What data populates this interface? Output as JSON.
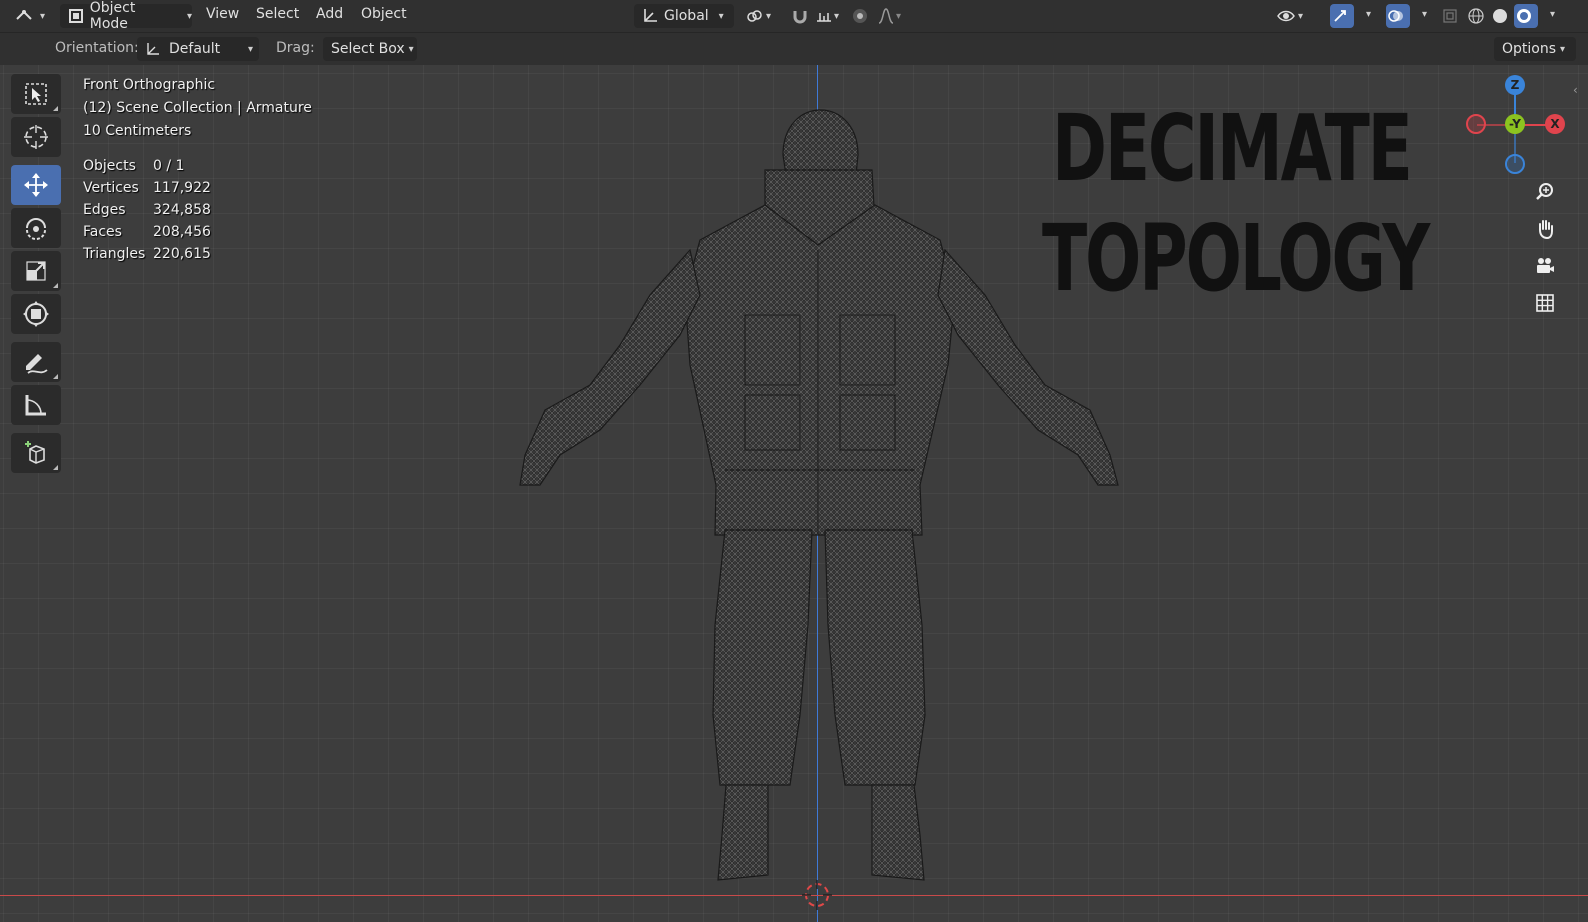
{
  "header": {
    "mode": "Object Mode",
    "menus": [
      "View",
      "Select",
      "Add",
      "Object"
    ],
    "transform_orientation": "Global",
    "options_label": "Options"
  },
  "toolsettings": {
    "orientation_label": "Orientation:",
    "orientation_value": "Default",
    "drag_label": "Drag:",
    "drag_value": "Select Box"
  },
  "viewport": {
    "view_name": "Front Orthographic",
    "collection": "(12) Scene Collection | Armature",
    "scale": "10 Centimeters",
    "stats": [
      {
        "label": "Objects",
        "value": "0 / 1"
      },
      {
        "label": "Vertices",
        "value": "117,922"
      },
      {
        "label": "Edges",
        "value": "324,858"
      },
      {
        "label": "Faces",
        "value": "208,456"
      },
      {
        "label": "Triangles",
        "value": "220,615"
      }
    ],
    "overlay_line1": "DECIMATE",
    "overlay_line2": "TOPOLOGY"
  },
  "gizmo": {
    "z": "Z",
    "y": "-Y",
    "x": "X",
    "colors": {
      "x": "#e0444d",
      "y": "#8cc320",
      "z": "#3a84d9"
    }
  },
  "tools": [
    "select-box-icon",
    "cursor-icon",
    "move-icon",
    "rotate-icon",
    "scale-icon",
    "transform-icon",
    "annotate-icon",
    "measure-icon",
    "add-cube-icon"
  ]
}
